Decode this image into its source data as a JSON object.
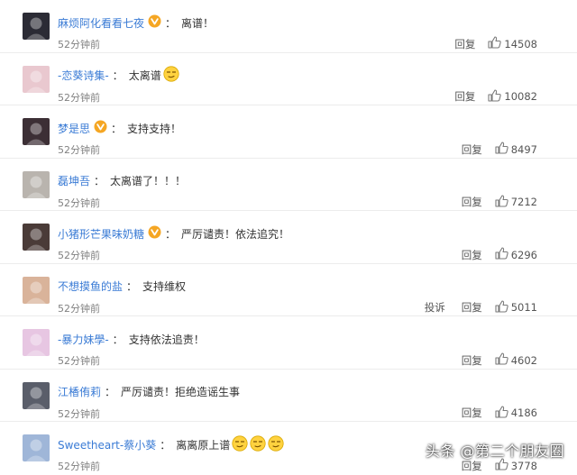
{
  "comments": [
    {
      "user": "麻烦阿化看看七夜",
      "verified": true,
      "text": "离谱！",
      "emoji": 0,
      "time": "52分钟前",
      "report": false,
      "likes": "14508",
      "avatar": "#2b2b35"
    },
    {
      "user": "-恋葵诗集-",
      "verified": false,
      "text": "太离谱",
      "emoji": 1,
      "time": "52分钟前",
      "report": false,
      "likes": "10082",
      "avatar": "#e9c8cf"
    },
    {
      "user": "梦是思",
      "verified": true,
      "text": "支持支持！",
      "emoji": 0,
      "time": "52分钟前",
      "report": false,
      "likes": "8497",
      "avatar": "#3c2f35"
    },
    {
      "user": "磊坤吾",
      "verified": false,
      "text": "太离谱了！！！",
      "emoji": 0,
      "time": "52分钟前",
      "report": false,
      "likes": "7212",
      "avatar": "#b9b4ae"
    },
    {
      "user": "小猪形芒果味奶糖",
      "verified": true,
      "text": "严厉谴责！依法追究！",
      "emoji": 0,
      "time": "52分钟前",
      "report": false,
      "likes": "6296",
      "avatar": "#4a3b38"
    },
    {
      "user": "不想摸鱼的盐",
      "verified": false,
      "text": "支持维权",
      "emoji": 0,
      "time": "52分钟前",
      "report": true,
      "likes": "5011",
      "avatar": "#d9b39a"
    },
    {
      "user": "-暴力妹學-",
      "verified": false,
      "text": "支持依法追责！",
      "emoji": 0,
      "time": "52分钟前",
      "report": false,
      "likes": "4602",
      "avatar": "#e7c6e2"
    },
    {
      "user": "江楿侑莉",
      "verified": false,
      "text": "严厉谴责！拒绝造谣生事",
      "emoji": 0,
      "time": "52分钟前",
      "report": false,
      "likes": "4186",
      "avatar": "#5a5e6a"
    },
    {
      "user": "Sweetheart-蔡小葵",
      "verified": false,
      "text": "离离原上谱",
      "emoji": 3,
      "time": "52分钟前",
      "report": false,
      "likes": "3778",
      "avatar": "#9fb6d8"
    }
  ],
  "labels": {
    "colon": "：",
    "reply": "回复",
    "report": "投诉"
  },
  "watermark": "头条 @第二个朋友圈",
  "colors": {
    "username": "#3a7bd5",
    "badge": "#f5a623",
    "muted": "#808080"
  },
  "icons": {
    "like": "thumbs-up-icon",
    "verified": "verified-v-badge-icon",
    "emoji": "smirk-face-icon"
  }
}
